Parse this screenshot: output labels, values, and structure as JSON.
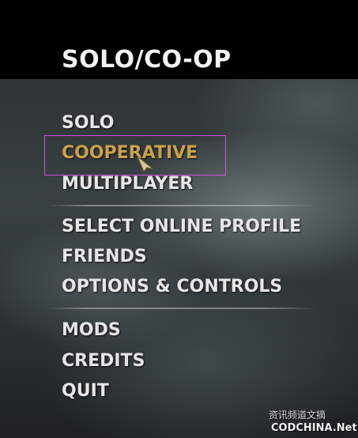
{
  "header": {
    "title": "SOLO/CO-OP"
  },
  "menu": {
    "items": [
      {
        "label": "SOLO"
      },
      {
        "label": "COOPERATIVE",
        "selected": true
      },
      {
        "label": "MULTIPLAYER"
      },
      {
        "label": "SELECT ONLINE PROFILE"
      },
      {
        "label": "FRIENDS"
      },
      {
        "label": "OPTIONS & CONTROLS"
      },
      {
        "label": "MODS"
      },
      {
        "label": "CREDITS"
      },
      {
        "label": "QUIT"
      }
    ]
  },
  "watermark": {
    "line1": "资讯频道文摘",
    "line2": "CODCHINA.Net"
  },
  "colors": {
    "selected_text": "#c9a24a",
    "text": "#e6e6e6",
    "highlight_box": "#d24fd8"
  }
}
